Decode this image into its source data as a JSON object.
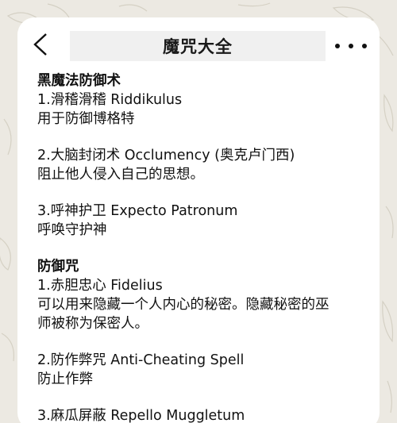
{
  "header": {
    "title": "魔咒大全",
    "back_icon": "chevron-left-icon",
    "more_icon": "more-horizontal-icon"
  },
  "sections": [
    {
      "heading": "黑魔法防御术",
      "items": [
        {
          "title": "1.滑稽滑稽  Riddikulus",
          "desc": [
            "用于防御博格特"
          ]
        },
        {
          "title": "2.大脑封闭术 Occlumency (奥克卢门西)",
          "desc": [
            "阻止他人侵入自己的思想。"
          ]
        },
        {
          "title": "3.呼神护卫 Expecto Patronum",
          "desc": [
            "呼唤守护神"
          ]
        }
      ]
    },
    {
      "heading": "防御咒",
      "items": [
        {
          "title": "1.赤胆忠心  Fidelius",
          "desc": [
            "可以用来隐藏一个人内心的秘密。隐藏秘密的巫",
            "师被称为保密人。"
          ]
        },
        {
          "title": "2.防作弊咒 Anti-Cheating Spell",
          "desc": [
            "防止作弊"
          ]
        },
        {
          "title": "3.麻瓜屏蔽  Repello  Muggletum",
          "desc": []
        }
      ]
    }
  ],
  "colors": {
    "background": "#ece9e2",
    "card": "#ffffff",
    "title_box": "#f0f0f0",
    "text": "#111111"
  }
}
